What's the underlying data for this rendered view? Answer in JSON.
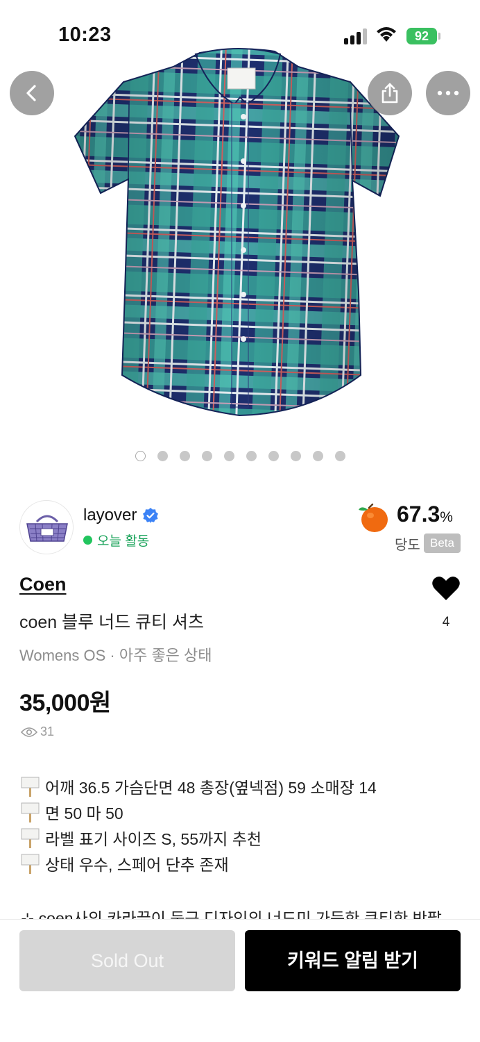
{
  "status_bar": {
    "time": "10:23",
    "battery": "92"
  },
  "gallery": {
    "image_count": 10,
    "active_index": 0
  },
  "seller": {
    "name": "layover",
    "activity": "오늘 활동",
    "sweetness_value": "67.3",
    "sweetness_unit": "%",
    "sweetness_label": "당도",
    "beta_label": "Beta"
  },
  "product": {
    "brand": "Coen",
    "title": "coen 블루 너드 큐티 셔츠",
    "meta": "Womens OS · 아주 좋은 상태",
    "price": "35,000원",
    "views": "31",
    "likes": "4",
    "description": [
      "어깨 36.5 가슴단면 48 총장(옆넥점) 59 소매장 14",
      "면 50 마 50",
      "라벨 표기 사이즈 S, 55까지 추천",
      "상태 우수, 스페어 단추 존재"
    ],
    "description_cut": "⊹ coen사의 카라끝이 둥근 디자인의 너드미 가득한 큐티한 반팔"
  },
  "actions": {
    "sold_out_label": "Sold Out",
    "keyword_alert_label": "키워드 알림 받기"
  },
  "colors": {
    "accent_green": "#22c55e",
    "verified_blue": "#3b82f6",
    "sold_out_bg": "#d6d6d6",
    "primary_bg": "#000000"
  }
}
